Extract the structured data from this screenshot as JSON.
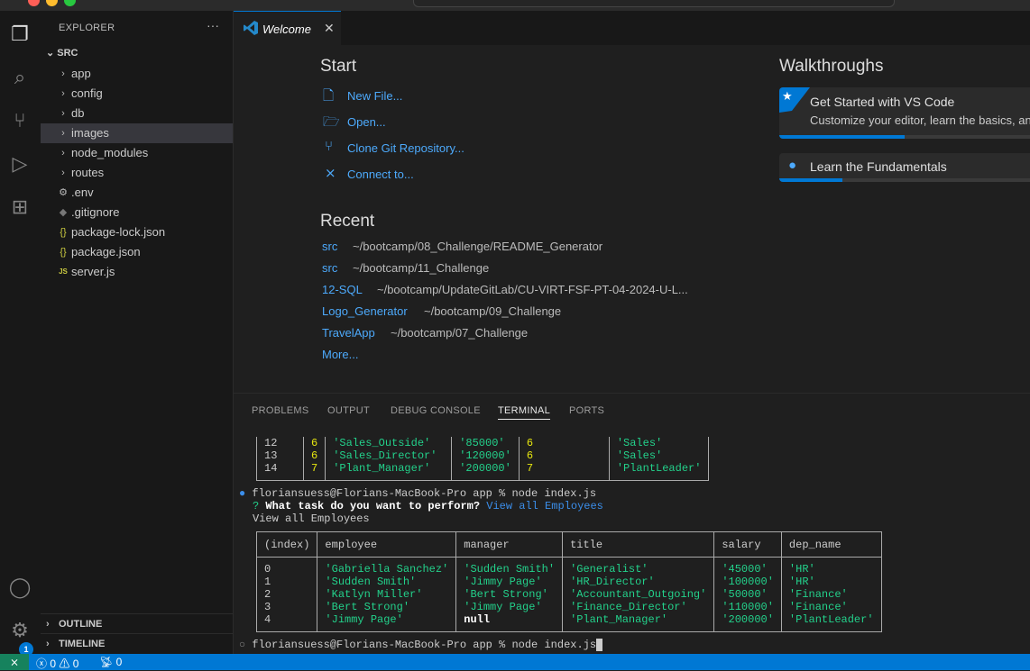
{
  "window": {
    "traffic": [
      "#ff5f57",
      "#febc2e",
      "#28c840"
    ]
  },
  "sidebar": {
    "title": "EXPLORER",
    "more": "···",
    "folder": "SRC",
    "items": [
      {
        "label": "app",
        "icon": "chevron-right"
      },
      {
        "label": "config",
        "icon": "chevron-right"
      },
      {
        "label": "db",
        "icon": "chevron-right"
      },
      {
        "label": "images",
        "icon": "chevron-right"
      },
      {
        "label": "node_modules",
        "icon": "chevron-right"
      },
      {
        "label": "routes",
        "icon": "chevron-right"
      },
      {
        "label": ".env",
        "icon": "gear"
      },
      {
        "label": ".gitignore",
        "icon": "diamond"
      },
      {
        "label": "package-lock.json",
        "icon": "braces"
      },
      {
        "label": "package.json",
        "icon": "braces"
      },
      {
        "label": "server.js",
        "icon": "js"
      }
    ],
    "outline": "OUTLINE",
    "timeline": "TIMELINE"
  },
  "activity": {
    "badge": "1"
  },
  "tab": {
    "label": "Welcome",
    "close": "✕"
  },
  "welcome": {
    "start_title": "Start",
    "start": [
      "New File...",
      "Open...",
      "Clone Git Repository...",
      "Connect to..."
    ],
    "recent_title": "Recent",
    "recent": [
      {
        "name": "src",
        "path": "~/bootcamp/08_Challenge/README_Generator"
      },
      {
        "name": "src",
        "path": "~/bootcamp/11_Challenge"
      },
      {
        "name": "12-SQL",
        "path": "~/bootcamp/UpdateGitLab/CU-VIRT-FSF-PT-04-2024-U-L..."
      },
      {
        "name": "Logo_Generator",
        "path": "~/bootcamp/09_Challenge"
      },
      {
        "name": "TravelApp",
        "path": "~/bootcamp/07_Challenge"
      }
    ],
    "more": "More...",
    "walk_title": "Walkthroughs",
    "walkthroughs": [
      {
        "title": "Get Started with VS Code",
        "desc": "Customize your editor, learn the basics, and start coding",
        "progress": 0.48
      },
      {
        "title": "Learn the Fundamentals",
        "progress": 0.24
      }
    ]
  },
  "panel": {
    "tabs": [
      "PROBLEMS",
      "OUTPUT",
      "DEBUG CONSOLE",
      "TERMINAL",
      "PORTS"
    ]
  },
  "terminal": {
    "prev_rows": [
      [
        "12",
        "6",
        "'Sales_Outside'",
        "'85000'",
        "6",
        "'Sales'"
      ],
      [
        "13",
        "6",
        "'Sales_Director'",
        "'120000'",
        "6",
        "'Sales'"
      ],
      [
        "14",
        "7",
        "'Plant_Manager'",
        "'200000'",
        "7",
        "'PlantLeader'"
      ]
    ],
    "prompt1": "floriansuess@Florians-MacBook-Pro app % node index.js",
    "question_mark": "?",
    "question": "What task do you want to perform?",
    "answer": "View all Employees",
    "echo": "View all Employees",
    "headers": [
      "(index)",
      "employee",
      "manager",
      "title",
      "salary",
      "dep_name"
    ],
    "rows": [
      [
        "0",
        "'Gabriella Sanchez'",
        "'Sudden Smith'",
        "'Generalist'",
        "'45000'",
        "'HR'"
      ],
      [
        "1",
        "'Sudden Smith'",
        "'Jimmy Page'",
        "'HR_Director'",
        "'100000'",
        "'HR'"
      ],
      [
        "2",
        "'Katlyn Miller'",
        "'Bert Strong'",
        "'Accountant_Outgoing'",
        "'50000'",
        "'Finance'"
      ],
      [
        "3",
        "'Bert Strong'",
        "'Jimmy Page'",
        "'Finance_Director'",
        "'110000'",
        "'Finance'"
      ],
      [
        "4",
        "'Jimmy Page'",
        "null",
        "'Plant_Manager'",
        "'200000'",
        "'PlantLeader'"
      ]
    ],
    "prompt2": "floriansuess@Florians-MacBook-Pro app % node index.js"
  },
  "status": {
    "errors": "0",
    "warnings": "0",
    "ports": "0"
  }
}
